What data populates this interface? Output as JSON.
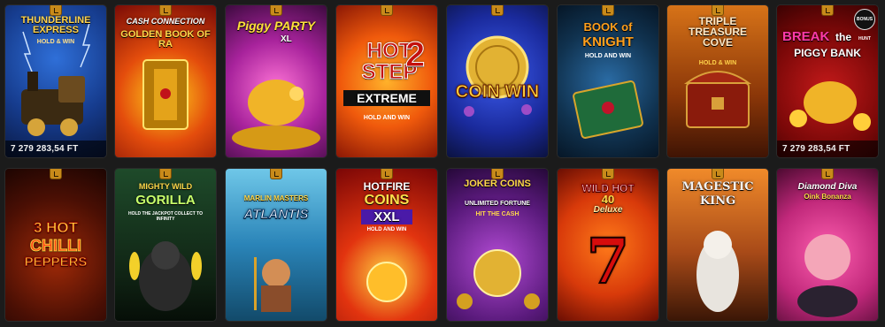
{
  "games": [
    {
      "title": "THUNDERLINE EXPRESS",
      "subtitle": "HOLD & WIN",
      "jackpot": "7 279 283,54 FT"
    },
    {
      "title_pre": "CASH CONNECTION",
      "title": "GOLDEN BOOK OF RA"
    },
    {
      "title": "Piggy PARTY",
      "title_post": "XL"
    },
    {
      "title_a": "HOT STEP",
      "title_num": "2",
      "title_b": "EXTREME",
      "subtitle": "HOLD AND WIN"
    },
    {
      "title": "COIN WIN"
    },
    {
      "title_a": "BOOK of",
      "title_b": "KNIGHT",
      "subtitle": "HOLD AND WIN"
    },
    {
      "title": "TRIPLE TREASURE COVE",
      "subtitle": "HOLD & WIN"
    },
    {
      "title_a": "BREAK",
      "title_b": "the",
      "title_c": "PIGGY BANK",
      "provider_badge": "BONUS HUNT",
      "jackpot": "7 279 283,54 FT"
    },
    {
      "title_a": "3 HOT",
      "title_b": "CHILLI",
      "title_c": "PEPPERS"
    },
    {
      "title_a": "MIGHTY WILD",
      "title_b": "GORILLA",
      "subtitle": "HOLD THE JACKPOT COLLECT TO INFINITY"
    },
    {
      "title_a": "MARLIN MASTERS",
      "title_b": "ATLANTIS"
    },
    {
      "title_a": "HOTFIRE",
      "title_b": "COINS",
      "title_c": "XXL",
      "subtitle": "HOLD AND WIN"
    },
    {
      "title_a": "JOKER COINS",
      "title_b": "UNLIMITED FORTUNE",
      "subtitle": "HIT THE CASH"
    },
    {
      "title_a": "WILD HOT",
      "title_b": "40",
      "title_c": "Deluxe",
      "symbol": "7"
    },
    {
      "title_a": "MAGESTIC",
      "title_b": "KING"
    },
    {
      "title_a": "Diamond Diva",
      "title_b": "Oink Bonanza"
    }
  ],
  "colors": {
    "background": "#1b1b1b",
    "badge": "#c88a1a"
  }
}
